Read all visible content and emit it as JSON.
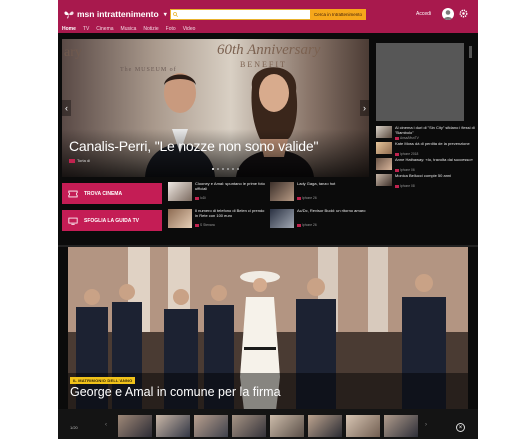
{
  "header": {
    "brand": "msn intrattenimento",
    "search": {
      "value": "",
      "placeholder": ""
    },
    "search_button": "Cerca in Intrattenimento",
    "signin": "Accedi",
    "nav": [
      "Home",
      "TV",
      "Cinema",
      "Musica",
      "Notizie",
      "Foto",
      "Video"
    ],
    "active_nav": "Home"
  },
  "hero": {
    "title": "Canalis-Perri, \"Le nozze non sono valide\"",
    "source": "Torta di",
    "backdrop": [
      "60th Anniversary",
      "BENEFIT",
      "The MUSEUM of",
      "ary"
    ],
    "dots": 6,
    "active_dot": 0
  },
  "side_list": [
    {
      "title": "Al cinema i duri di \"Sin City\" sfidano i fiessi di \"Bambolo\"",
      "source": "Ansa/MsnTV"
    },
    {
      "title": "Kate Moss dà di perdita de la prevenzione",
      "source": "Iphone 2018"
    },
    {
      "title": "Anne Hathaway: «Io, travolta dai successo»",
      "source": "Iphone 06"
    },
    {
      "title": "Monica Bellucci compie 50 anni",
      "source": "Iphone 08"
    }
  ],
  "cta": {
    "cinema": "TROVA CINEMA",
    "tv": "SFOGLIA LA GUIDA TV"
  },
  "news_grid": [
    {
      "title": "Clooney e Amal: spuntano le prime foto ufficiali",
      "source": "IoDi"
    },
    {
      "title": "Lady Gaga, tanzo hot",
      "source": "Iphone 26"
    },
    {
      "title": "Il numero di telefono di Belen ci prendo in Rete con 100 euro",
      "source": "S Stenara"
    },
    {
      "title": "Ac/Dc, Revisor Budd: un ritorno amaro",
      "source": "Iphone 26"
    }
  ],
  "feature": {
    "tag": "IL MATRIMONIO DELL'ANNO",
    "title": "George e Amal in comune per la firma",
    "counter": "1/20",
    "thumbs": 9
  },
  "colors": {
    "brand": "#a8194d",
    "cta": "#c41d55",
    "search_button": "#f6a71b",
    "tag": "#f0c21a"
  },
  "icons": {
    "brand": "butterfly-icon",
    "search": "search-icon",
    "settings": "gear-icon",
    "avatar": "user-icon",
    "cinema": "ticket-icon",
    "tv": "tv-icon",
    "close": "close-icon"
  }
}
